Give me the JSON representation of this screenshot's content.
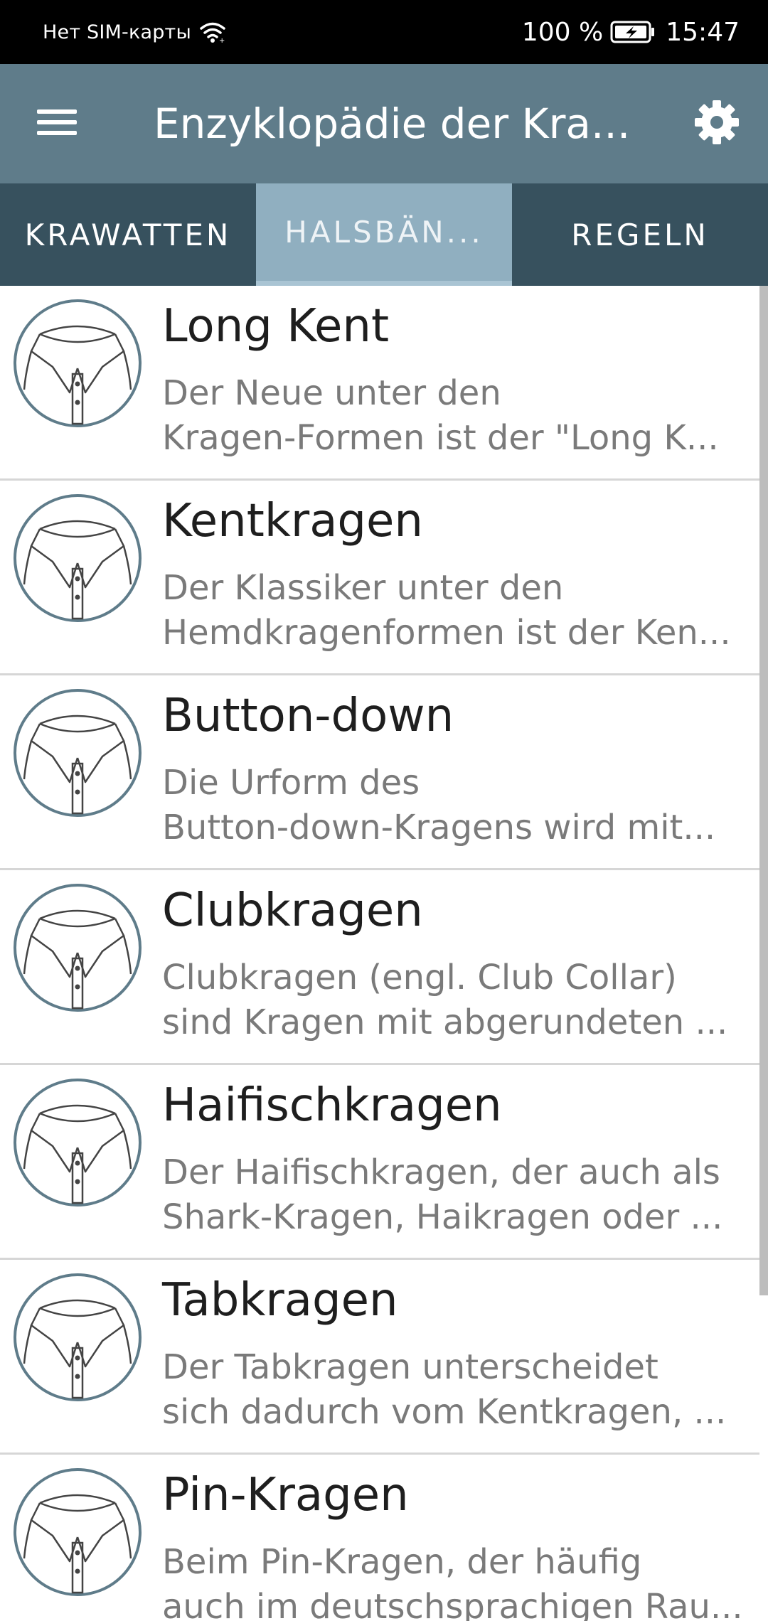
{
  "status": {
    "carrier": "Нет SIM-карты",
    "battery": "100 %",
    "time": "15:47"
  },
  "appbar": {
    "title": "Enzyklopädie der Kra...",
    "menu_icon": "hamburger-menu-icon",
    "settings_icon": "gear-icon"
  },
  "tabs": [
    {
      "label": "KRAWATTEN"
    },
    {
      "label": "HALSBÄN..."
    },
    {
      "label": "REGELN"
    }
  ],
  "colors": {
    "appbar": "#5f7c8a",
    "tabbar": "#37515e",
    "active_tab": "#90afc0",
    "icon_ring": "#5f7c8a"
  },
  "items": [
    {
      "title": "Long Kent",
      "desc1": "Der Neue unter den",
      "desc2": "Kragen-Formen ist der \"Long K..."
    },
    {
      "title": "Kentkragen",
      "desc1": "Der Klassiker unter den",
      "desc2": "Hemdkragenformen ist der Ken..."
    },
    {
      "title": "Button-down",
      "desc1": "Die Urform des",
      "desc2": "Button-down-Kragens wird mit..."
    },
    {
      "title": "Clubkragen",
      "desc1": "Clubkragen (engl. Club Collar)",
      "desc2": "sind Kragen mit abgerundeten ..."
    },
    {
      "title": "Haifischkragen",
      "desc1": "Der Haifischkragen, der auch als",
      "desc2": "Shark-Kragen, Haikragen oder ..."
    },
    {
      "title": "Tabkragen",
      "desc1": "Der Tabkragen unterscheidet",
      "desc2": "sich dadurch vom Kentkragen, ..."
    },
    {
      "title": "Pin-Kragen",
      "desc1": "Beim Pin-Kragen, der häufig",
      "desc2": "auch im deutschsprachigen Rau..."
    }
  ]
}
